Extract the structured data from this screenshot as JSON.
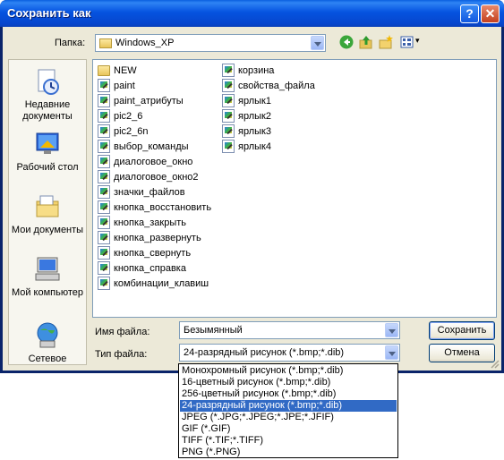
{
  "window": {
    "title": "Сохранить как",
    "help_label": "?",
    "close_label": "✕"
  },
  "toolbar": {
    "folder_label": "Папка:",
    "folder_value": "Windows_XP",
    "views_arrow": "▾"
  },
  "places": [
    {
      "label": "Недавние документы",
      "icon": "recent-documents-icon"
    },
    {
      "label": "Рабочий стол",
      "icon": "desktop-icon"
    },
    {
      "label": "Мои документы",
      "icon": "my-documents-icon"
    },
    {
      "label": "Мой компьютер",
      "icon": "my-computer-icon"
    },
    {
      "label": "Сетевое",
      "icon": "network-icon"
    }
  ],
  "files": {
    "column1": [
      {
        "name": "NEW",
        "type": "folder"
      },
      {
        "name": "paint",
        "type": "file"
      },
      {
        "name": "paint_атрибуты",
        "type": "file"
      },
      {
        "name": "pic2_6",
        "type": "file"
      },
      {
        "name": "pic2_6n",
        "type": "file"
      },
      {
        "name": "выбор_команды",
        "type": "file"
      },
      {
        "name": "диалоговое_окно",
        "type": "file"
      },
      {
        "name": "диалоговое_окно2",
        "type": "file"
      },
      {
        "name": "значки_файлов",
        "type": "file"
      },
      {
        "name": "кнопка_восстановить",
        "type": "file"
      },
      {
        "name": "кнопка_закрыть",
        "type": "file"
      },
      {
        "name": "кнопка_развернуть",
        "type": "file"
      },
      {
        "name": "кнопка_свернуть",
        "type": "file"
      },
      {
        "name": "кнопка_справка",
        "type": "file"
      },
      {
        "name": "комбинации_клавиш",
        "type": "file"
      }
    ],
    "column2": [
      {
        "name": "корзина",
        "type": "file"
      },
      {
        "name": "свойства_файла",
        "type": "file"
      },
      {
        "name": "ярлык1",
        "type": "file"
      },
      {
        "name": "ярлык2",
        "type": "file"
      },
      {
        "name": "ярлык3",
        "type": "file"
      },
      {
        "name": "ярлык4",
        "type": "file"
      }
    ]
  },
  "filename": {
    "label": "Имя файла:",
    "value": "Безымянный"
  },
  "filetype": {
    "label": "Тип файла:",
    "value": "24-разрядный рисунок (*.bmp;*.dib)",
    "options": [
      "Монохромный рисунок (*.bmp;*.dib)",
      "16-цветный рисунок (*.bmp;*.dib)",
      "256-цветный рисунок (*.bmp;*.dib)",
      "24-разрядный рисунок (*.bmp;*.dib)",
      "JPEG (*.JPG;*.JPEG;*.JPE;*.JFIF)",
      "GIF (*.GIF)",
      "TIFF (*.TIF;*.TIFF)",
      "PNG (*.PNG)"
    ],
    "selected_index": 3
  },
  "buttons": {
    "save": "Сохранить",
    "cancel": "Отмена"
  }
}
